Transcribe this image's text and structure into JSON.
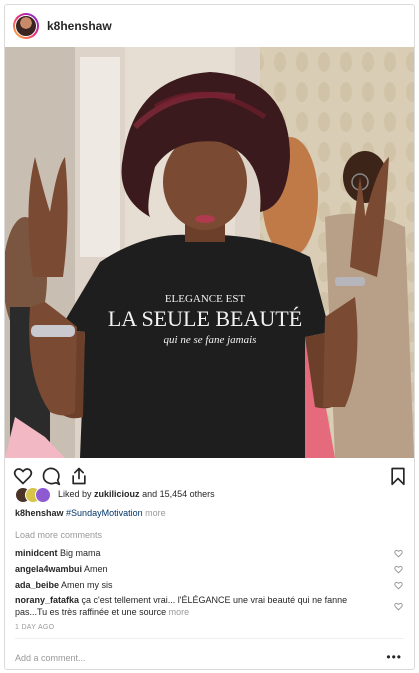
{
  "post": {
    "username": "k8henshaw",
    "photo_print": {
      "line1": "ELEGANCE EST",
      "line2": "LA SEULE BEAUTÉ",
      "line3": "qui ne se fane jamais"
    }
  },
  "actions": {
    "icons": [
      "heart-icon",
      "comment-icon",
      "share-icon",
      "bookmark-icon"
    ]
  },
  "likes": {
    "prefix": "Liked by",
    "user": "zukiliciouz",
    "suffix": "and 15,454 others"
  },
  "caption": {
    "username": "k8henshaw",
    "hashtag": "#SundayMotivation",
    "more": "more"
  },
  "comments": {
    "load_more": "Load more comments",
    "items": [
      {
        "username": "minidcent",
        "text": "Big mama"
      },
      {
        "username": "angela4wambui",
        "text": "Amen"
      },
      {
        "username": "ada_beibe",
        "text": "Amen my sis"
      }
    ],
    "long": {
      "username": "norany_fatafka",
      "text": "ça c'est tellement vrai⁣... l'ÉLÉGANCE une vrai beauté qui ne fanne pas...Tu es très raffinée et une source",
      "more": "more"
    }
  },
  "timestamp": "1 DAY AGO",
  "add_comment": {
    "placeholder": "Add a comment...",
    "options_glyph": "•••"
  },
  "colors": {
    "accent_link": "#003569",
    "muted": "#999999",
    "border": "#dbdbdb"
  }
}
